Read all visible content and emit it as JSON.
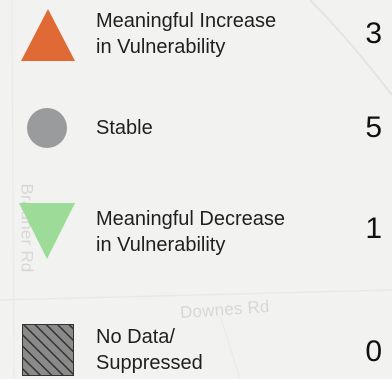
{
  "legend": {
    "items": [
      {
        "symbol": "triangle-up-icon",
        "color": "#e06a35",
        "label_line1": "Meaningful Increase",
        "label_line2": "in Vulnerability",
        "count": "3"
      },
      {
        "symbol": "circle-icon",
        "color": "#9a9b9d",
        "label_line1": "Stable",
        "label_line2": "",
        "count": "5"
      },
      {
        "symbol": "triangle-down-icon",
        "color": "#9ddc98",
        "label_line1": "Meaningful Decrease",
        "label_line2": "in Vulnerability",
        "count": "1"
      },
      {
        "symbol": "hatched-square-icon",
        "color": "#5a5a5a",
        "label_line1": "No Data/",
        "label_line2": "Suppressed",
        "count": "0"
      }
    ]
  },
  "map": {
    "road_1": "Bradner Rd",
    "road_2": "Downes Rd"
  }
}
